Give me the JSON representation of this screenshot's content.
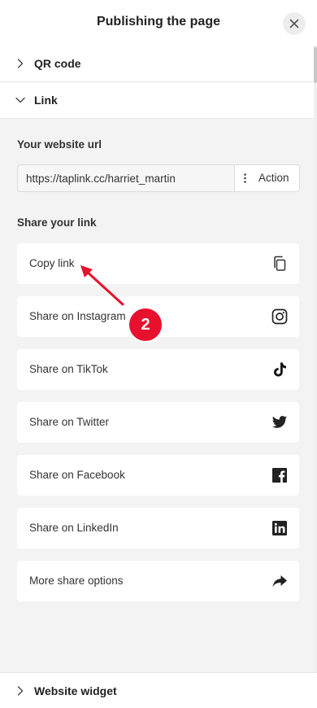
{
  "header": {
    "title": "Publishing the page",
    "close_icon": "close-icon"
  },
  "sections": {
    "qr": {
      "label": "QR code",
      "state": "collapsed"
    },
    "link": {
      "label": "Link",
      "state": "expanded"
    },
    "widget": {
      "label": "Website widget",
      "state": "collapsed"
    }
  },
  "link_panel": {
    "url_label": "Your website url",
    "url_value": "https://taplink.cc/harriet_martin",
    "action_label": "Action",
    "share_label": "Share your link",
    "items": [
      {
        "label": "Copy link",
        "icon": "copy-icon"
      },
      {
        "label": "Share on Instagram",
        "icon": "instagram-icon"
      },
      {
        "label": "Share on TikTok",
        "icon": "tiktok-icon"
      },
      {
        "label": "Share on Twitter",
        "icon": "twitter-icon"
      },
      {
        "label": "Share on Facebook",
        "icon": "facebook-icon"
      },
      {
        "label": "Share on LinkedIn",
        "icon": "linkedin-icon"
      },
      {
        "label": "More share options",
        "icon": "share-arrow-icon"
      }
    ]
  },
  "annotation": {
    "step": "2",
    "color": "#e8112d"
  },
  "colors": {
    "panel_background": "#f3f3f3",
    "card_background": "#ffffff",
    "divider": "#e6e6e6",
    "text": "#222222"
  }
}
